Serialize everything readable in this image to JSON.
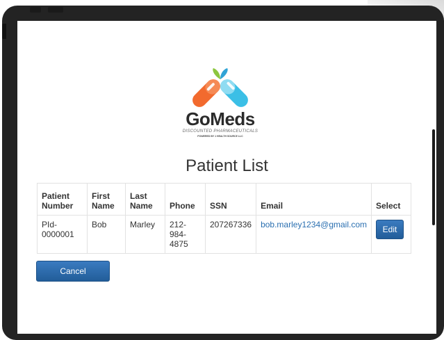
{
  "brand": {
    "name": "GoMeds",
    "tagline": "DISCOUNTED PHARMACEUTICALS",
    "powered_by": "POWERED BY 1 HEALTH SOURCE LLC"
  },
  "page": {
    "title": "Patient List"
  },
  "table": {
    "headers": {
      "patient_number": "Patient Number",
      "first_name": "First Name",
      "last_name": "Last Name",
      "phone": "Phone",
      "ssn": "SSN",
      "email": "Email",
      "select": "Select"
    },
    "rows": [
      {
        "patient_number": "PId-0000001",
        "first_name": "Bob",
        "last_name": "Marley",
        "phone": "212-984-4875",
        "ssn": "207267336",
        "email": "bob.marley1234@gmail.com",
        "action": "Edit"
      }
    ]
  },
  "actions": {
    "cancel": "Cancel"
  },
  "colors": {
    "button_blue": "#2a6aad",
    "link_blue": "#2a6fb0",
    "logo_orange": "#f26a2e",
    "logo_cyan": "#3bbfe6",
    "logo_green": "#8cc63f"
  },
  "icons": [
    "pill-capsule-logo-icon"
  ]
}
